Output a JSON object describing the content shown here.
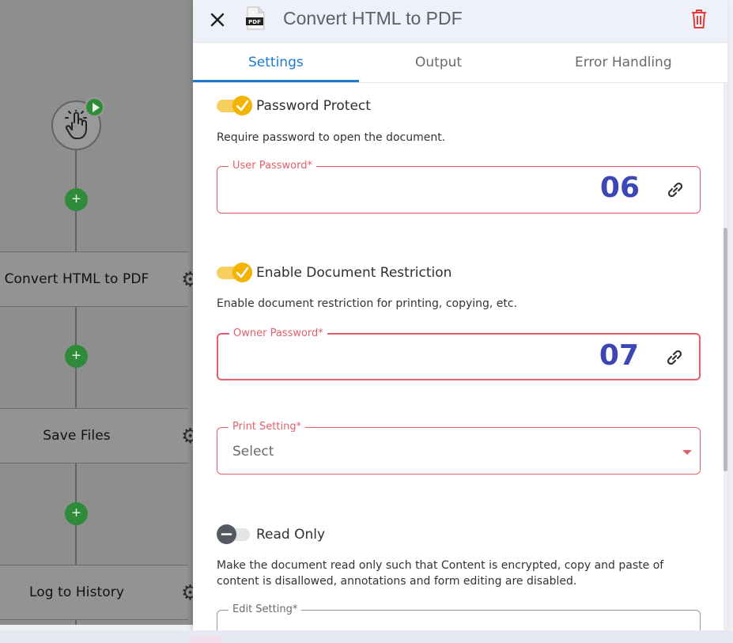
{
  "workflow": {
    "nodes": [
      {
        "label": "Convert HTML to PDF"
      },
      {
        "label": "Save Files"
      },
      {
        "label": "Log to History"
      }
    ],
    "plus_symbol": "+",
    "icons": {
      "trigger": "pointer-hand-icon",
      "play": "play-icon",
      "settings": "gear-icon"
    }
  },
  "panel": {
    "title": "Convert HTML to PDF",
    "icons": {
      "close": "close-icon",
      "file": "pdf-file-icon",
      "delete": "trash-icon"
    },
    "pdf_badge": "PDF",
    "tabs": [
      {
        "label": "Settings",
        "active": true
      },
      {
        "label": "Output",
        "active": false
      },
      {
        "label": "Error Handling",
        "active": false
      }
    ],
    "password_protect": {
      "label": "Password Protect",
      "enabled": true,
      "description": "Require password to open the document.",
      "field_label": "User Password*",
      "field_value": "06"
    },
    "document_restriction": {
      "label": "Enable Document Restriction",
      "enabled": true,
      "description": "Enable document restriction for printing, copying, etc.",
      "field_label": "Owner Password*",
      "field_value": "07"
    },
    "print_setting": {
      "label": "Print Setting*",
      "value": "Select"
    },
    "read_only": {
      "label": "Read Only",
      "enabled": false,
      "description": "Make the document read only such that Content is encrypted, copy and paste of content is disallowed, annotations and form editing are disabled."
    },
    "edit_setting": {
      "label": "Edit Setting*"
    }
  },
  "colors": {
    "accent": "#1a7bd1",
    "toggle_on": "#f2b400",
    "required_border": "#e0606a",
    "value_text": "#3b47b4",
    "node_add": "#2e8b3a",
    "delete": "#e53935"
  }
}
